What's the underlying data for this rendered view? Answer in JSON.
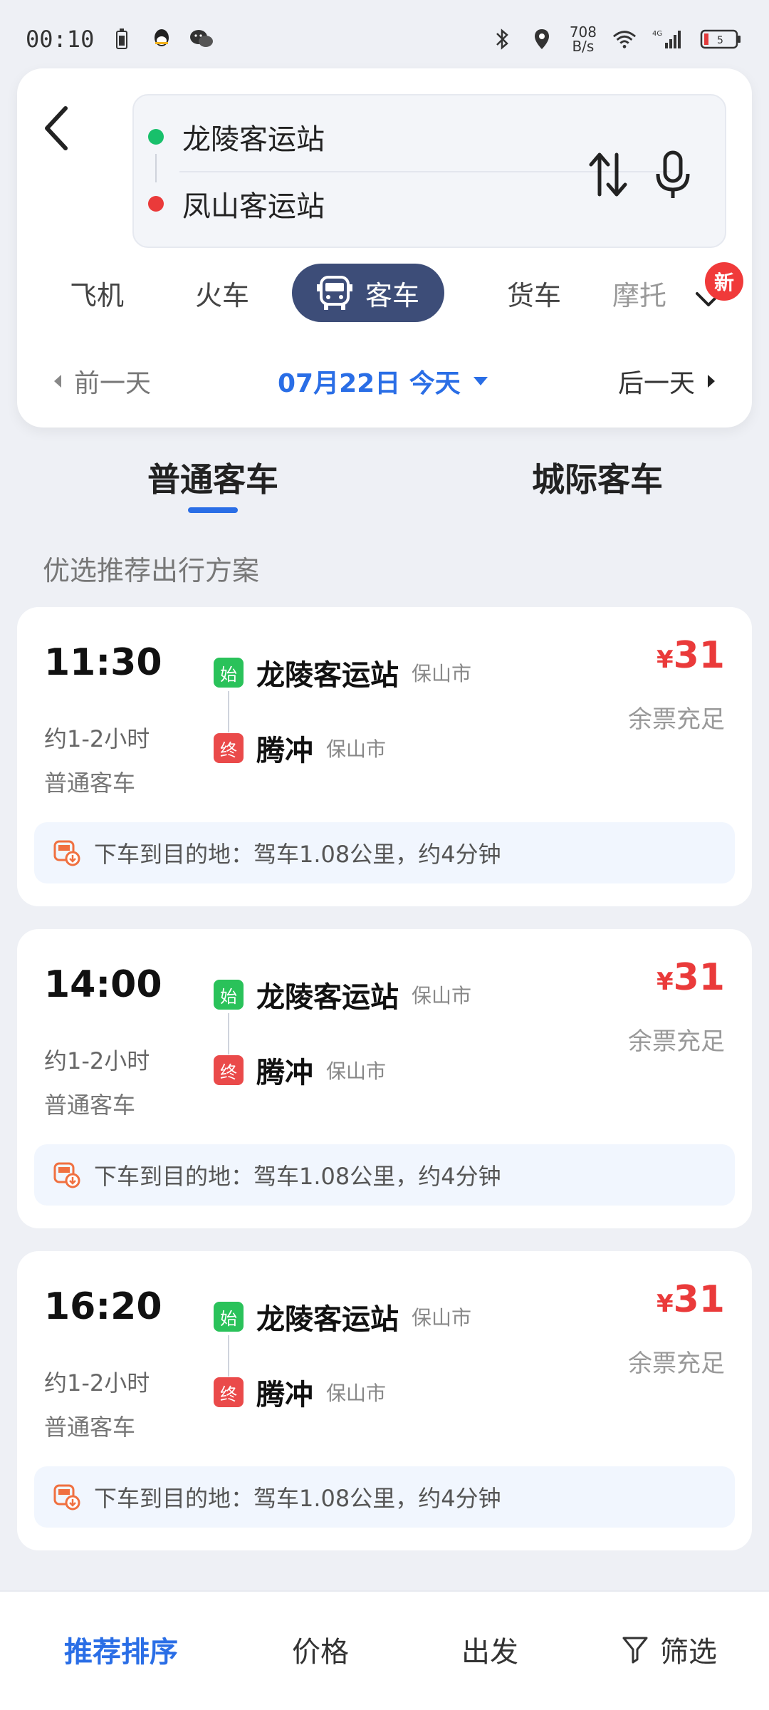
{
  "status_bar": {
    "time": "00:10",
    "net_speed_value": "708",
    "net_speed_unit": "B/s",
    "network": "4G"
  },
  "route": {
    "from": "龙陵客运站",
    "to": "凤山客运站"
  },
  "transport_tabs": [
    {
      "label": "飞机"
    },
    {
      "label": "火车"
    },
    {
      "label": "客车",
      "active": true
    },
    {
      "label": "货车"
    },
    {
      "label": "摩托"
    }
  ],
  "badges": {
    "new": "新"
  },
  "date_bar": {
    "prev": "前一天",
    "current": "07月22日 今天",
    "next": "后一天"
  },
  "sub_tabs": [
    {
      "label": "普通客车",
      "active": true
    },
    {
      "label": "城际客车"
    }
  ],
  "section_title": "优选推荐出行方案",
  "trips": [
    {
      "time": "11:30",
      "duration": "约1-2小时",
      "type": "普通客车",
      "start_badge": "始",
      "start_station": "龙陵客运站",
      "start_city": "保山市",
      "end_badge": "终",
      "end_station": "腾冲",
      "end_city": "保山市",
      "price_symbol": "¥",
      "price": "31",
      "ticket_status": "余票充足",
      "note": "下车到目的地：驾车1.08公里，约4分钟"
    },
    {
      "time": "14:00",
      "duration": "约1-2小时",
      "type": "普通客车",
      "start_badge": "始",
      "start_station": "龙陵客运站",
      "start_city": "保山市",
      "end_badge": "终",
      "end_station": "腾冲",
      "end_city": "保山市",
      "price_symbol": "¥",
      "price": "31",
      "ticket_status": "余票充足",
      "note": "下车到目的地：驾车1.08公里，约4分钟"
    },
    {
      "time": "16:20",
      "duration": "约1-2小时",
      "type": "普通客车",
      "start_badge": "始",
      "start_station": "龙陵客运站",
      "start_city": "保山市",
      "end_badge": "终",
      "end_station": "腾冲",
      "end_city": "保山市",
      "price_symbol": "¥",
      "price": "31",
      "ticket_status": "余票充足",
      "note": "下车到目的地：驾车1.08公里，约4分钟"
    }
  ],
  "sort_bar": [
    {
      "label": "推荐排序",
      "active": true
    },
    {
      "label": "价格"
    },
    {
      "label": "出发"
    },
    {
      "label": "筛选"
    }
  ],
  "colors": {
    "accent_blue": "#2a6ee6",
    "price_red": "#ea3a3a",
    "active_tab_bg": "#3d4d78"
  }
}
